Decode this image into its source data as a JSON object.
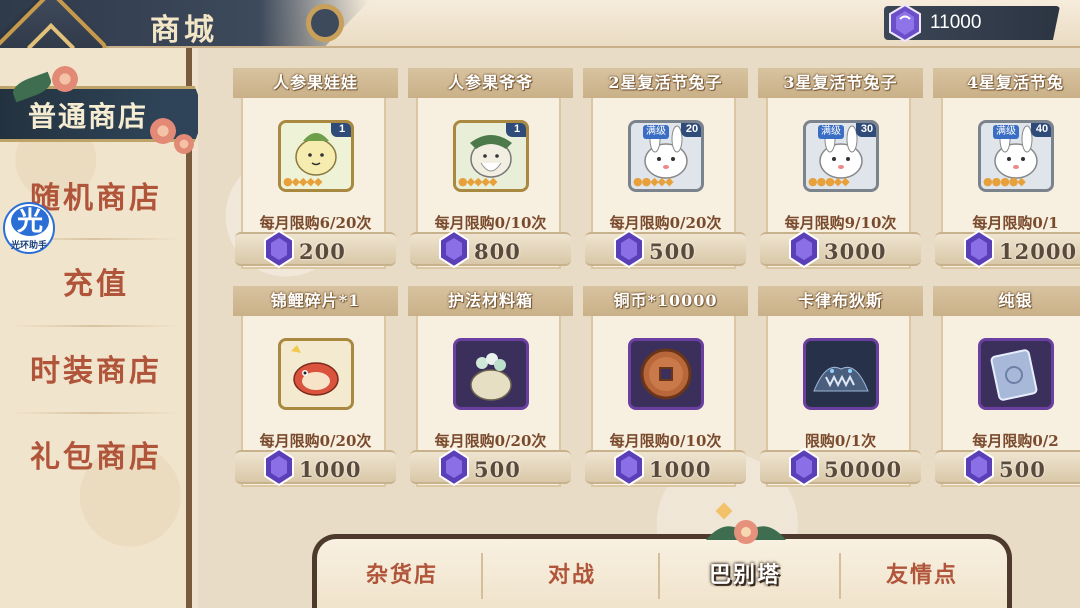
{
  "header": {
    "title": "商城",
    "currency_value": "11000"
  },
  "sidebar": {
    "items": [
      {
        "label": "普通商店",
        "active": true
      },
      {
        "label": "随机商店",
        "active": false
      },
      {
        "label": "充值",
        "active": false
      },
      {
        "label": "时装商店",
        "active": false
      },
      {
        "label": "礼包商店",
        "active": false
      }
    ],
    "badge": {
      "glyph": "光",
      "label": "光环助手"
    }
  },
  "shop": {
    "row1": [
      {
        "name": "人参果娃娃",
        "limit": "每月限购6/20次",
        "price": "200",
        "level": "1",
        "icon": "ginseng-baby-icon"
      },
      {
        "name": "人参果爷爷",
        "limit": "每月限购0/10次",
        "price": "800",
        "level": "1",
        "icon": "ginseng-grandpa-icon"
      },
      {
        "name": "2星复活节兔子",
        "limit": "每月限购0/20次",
        "price": "500",
        "level": "20",
        "max": "满级",
        "icon": "easter-bunny-icon"
      },
      {
        "name": "3星复活节兔子",
        "limit": "每月限购9/10次",
        "price": "3000",
        "level": "30",
        "max": "满级",
        "icon": "easter-bunny-icon"
      },
      {
        "name": "4星复活节兔",
        "limit": "每月限购0/1",
        "price": "12000",
        "level": "40",
        "max": "满级",
        "icon": "easter-bunny-icon"
      }
    ],
    "row2": [
      {
        "name": "锦鲤碎片*1",
        "limit": "每月限购0/20次",
        "price": "1000",
        "icon": "koi-fragment-icon"
      },
      {
        "name": "护法材料箱",
        "limit": "每月限购0/20次",
        "price": "500",
        "icon": "material-sack-icon"
      },
      {
        "name": "铜币*10000",
        "limit": "每月限购0/10次",
        "price": "1000",
        "icon": "copper-coin-icon"
      },
      {
        "name": "卡律布狄斯",
        "limit": "限购0/1次",
        "price": "50000",
        "icon": "charybdis-icon"
      },
      {
        "name": "纯银",
        "limit": "每月限购0/2",
        "price": "500",
        "icon": "pure-silver-icon"
      }
    ]
  },
  "tabs": [
    {
      "label": "杂货店",
      "active": false
    },
    {
      "label": "对战",
      "active": false
    },
    {
      "label": "巴别塔",
      "active": true
    },
    {
      "label": "友情点",
      "active": false
    }
  ],
  "colors": {
    "accent": "#b0553a",
    "plate": "#2f3a4a",
    "gem": "#6b4fc9"
  }
}
